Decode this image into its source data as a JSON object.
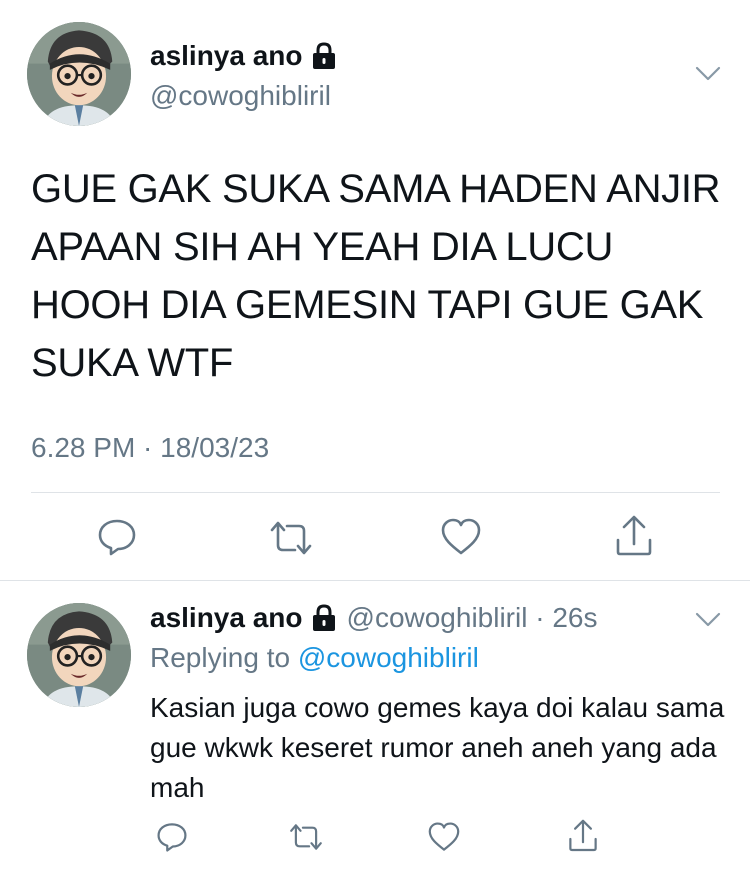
{
  "main_tweet": {
    "display_name": "aslinya ano",
    "handle": "@cowoghibliril",
    "text": "GUE GAK SUKA SAMA HADEN ANJIR APAAN SIH AH YEAH DIA LUCU HOOH DIA GEMESIN TAPI GUE GAK SUKA WTF",
    "timestamp": "6.28 PM · 18/03/23",
    "actions": [
      "reply-icon",
      "retweet-icon",
      "like-icon",
      "share-icon"
    ]
  },
  "reply_tweet": {
    "display_name": "aslinya ano",
    "handle_time": "@cowoghibliril · 26s",
    "replying_to_prefix": "Replying to ",
    "replying_to_handle": "@cowoghibliril",
    "text": "Kasian juga cowo gemes kaya doi kalau sama gue wkwk keseret rumor aneh aneh yang ada mah",
    "actions": [
      "reply-icon",
      "retweet-icon",
      "like-icon",
      "share-icon"
    ]
  },
  "colors": {
    "text": "#0f1419",
    "secondary": "#657786",
    "mention": "#1b95e0",
    "icon": "#657786",
    "divider": "#dfe3e7"
  }
}
